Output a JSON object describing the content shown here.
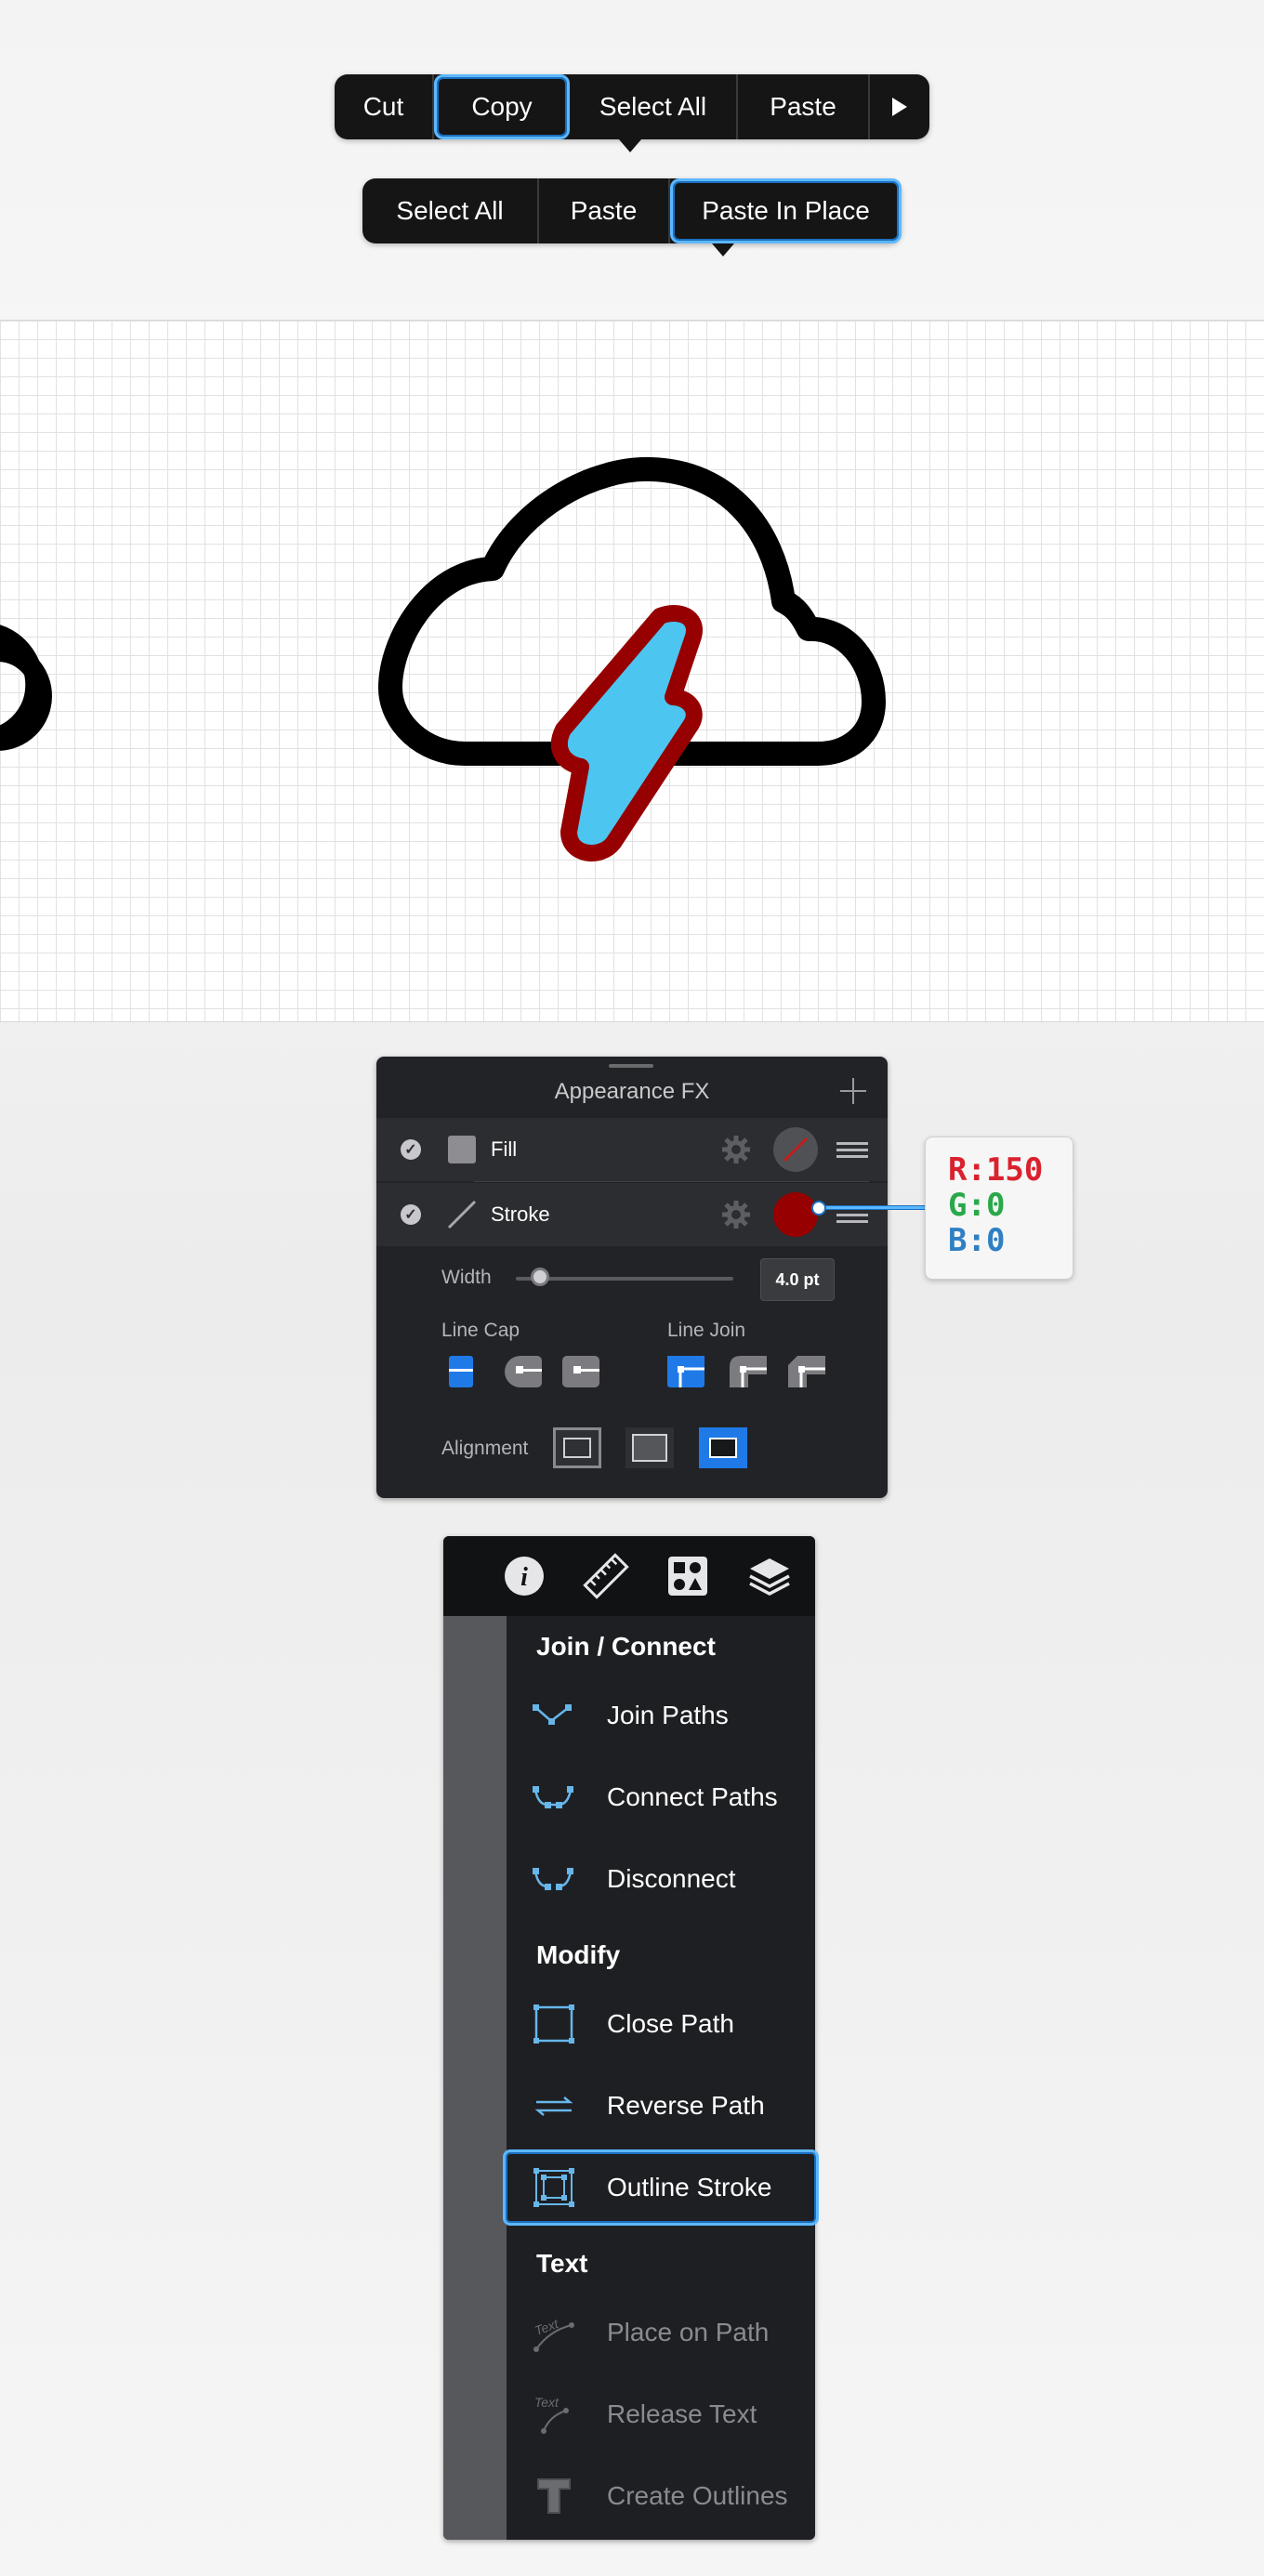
{
  "context_menu_1": {
    "items": [
      "Cut",
      "Copy",
      "Select All",
      "Paste"
    ],
    "highlighted": "Copy",
    "more_icon": "play-arrow-icon"
  },
  "context_menu_2": {
    "items": [
      "Select All",
      "Paste",
      "Paste In Place"
    ],
    "highlighted": "Paste In Place"
  },
  "canvas": {
    "object": "cloud-lightning-icon",
    "lightning_fill": "#4cc6f0",
    "lightning_stroke": "#960000",
    "cloud_stroke": "#000000"
  },
  "appearance": {
    "title": "Appearance FX",
    "fill_label": "Fill",
    "stroke_label": "Stroke",
    "stroke_color": "#960000",
    "width_label": "Width",
    "width_value": "4.0 pt",
    "line_cap_label": "Line Cap",
    "line_join_label": "Line Join",
    "alignment_label": "Alignment"
  },
  "rgb": {
    "r": "R:150",
    "g": "G:0",
    "b": "B:0"
  },
  "menu": {
    "sections": [
      {
        "title": "Join / Connect",
        "items": [
          {
            "label": "Join Paths",
            "icon": "join-paths-icon"
          },
          {
            "label": "Connect Paths",
            "icon": "connect-paths-icon"
          },
          {
            "label": "Disconnect",
            "icon": "disconnect-icon"
          }
        ]
      },
      {
        "title": "Modify",
        "items": [
          {
            "label": "Close Path",
            "icon": "close-path-icon"
          },
          {
            "label": "Reverse Path",
            "icon": "reverse-path-icon"
          },
          {
            "label": "Outline Stroke",
            "icon": "outline-stroke-icon",
            "highlighted": true
          }
        ]
      },
      {
        "title": "Text",
        "items": [
          {
            "label": "Place on Path",
            "icon": "text-on-path-icon",
            "disabled": true
          },
          {
            "label": "Release Text",
            "icon": "release-text-icon",
            "disabled": true
          },
          {
            "label": "Create Outlines",
            "icon": "create-outlines-icon",
            "disabled": true
          }
        ]
      }
    ],
    "toolbar_icons": [
      "info-icon",
      "ruler-icon",
      "shapes-icon",
      "layers-icon"
    ]
  },
  "colors": {
    "accent": "#1f7ae8",
    "highlight_border": "#5cb8ff",
    "r_color": "#d9222e",
    "g_color": "#2aa84a",
    "b_color": "#2f7fc4"
  }
}
